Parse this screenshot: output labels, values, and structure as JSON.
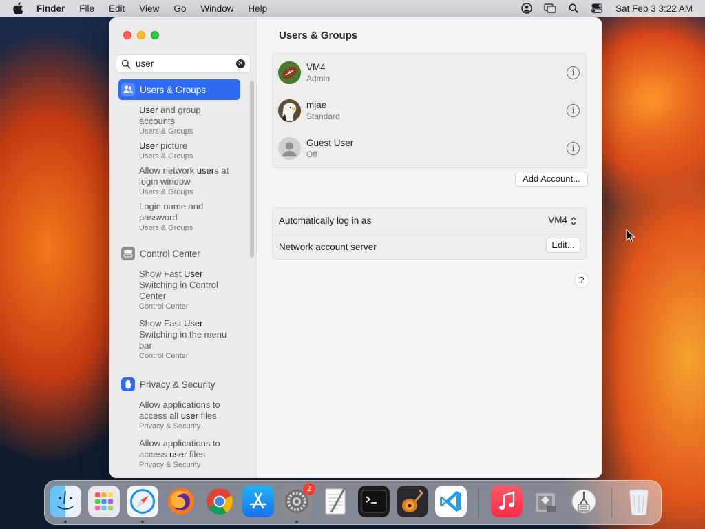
{
  "menubar": {
    "items": [
      "Finder",
      "File",
      "Edit",
      "View",
      "Go",
      "Window",
      "Help"
    ],
    "clock": "Sat Feb 3  3:22 AM"
  },
  "window": {
    "search": {
      "value": "user"
    },
    "sidebar": {
      "categories": [
        {
          "label_hl": "User",
          "label_rest": "s & Groups",
          "results": [
            {
              "pre": "",
              "hl": "User",
              "post": " and group accounts",
              "sub": "Users & Groups"
            },
            {
              "pre": "",
              "hl": "User",
              "post": " picture",
              "sub": "Users & Groups"
            },
            {
              "pre": "Allow network ",
              "hl": "user",
              "post": "s at login window",
              "sub": "Users & Groups"
            },
            {
              "pre": "Login name and password",
              "hl": "",
              "post": "",
              "sub": "Users & Groups"
            }
          ]
        },
        {
          "label_hl": "",
          "label_rest": "Control Center",
          "results": [
            {
              "pre": "Show Fast ",
              "hl": "User",
              "post": " Switching in Control Center",
              "sub": "Control Center"
            },
            {
              "pre": "Show Fast ",
              "hl": "User",
              "post": " Switching in the menu bar",
              "sub": "Control Center"
            }
          ]
        },
        {
          "label_hl": "",
          "label_rest": "Privacy & Security",
          "results": [
            {
              "pre": "Allow applications to access all ",
              "hl": "user",
              "post": " files",
              "sub": "Privacy & Security"
            },
            {
              "pre": "Allow applications to access ",
              "hl": "user",
              "post": " files",
              "sub": "Privacy & Security"
            }
          ]
        }
      ]
    },
    "main": {
      "title": "Users & Groups",
      "users": [
        {
          "name": "VM4",
          "role": "Admin"
        },
        {
          "name": "mjae",
          "role": "Standard"
        },
        {
          "name": "Guest User",
          "role": "Off"
        }
      ],
      "add_account": "Add Account...",
      "autologin_label": "Automatically log in as",
      "autologin_value": "VM4",
      "network_label": "Network account server",
      "edit_label": "Edit...",
      "help": "?",
      "info_glyph": "i"
    }
  },
  "dock": {
    "system_settings_badge": "2",
    "apps": [
      "Finder",
      "Launchpad",
      "Safari",
      "Firefox",
      "Chrome",
      "App Store",
      "System Settings",
      "TextEdit",
      "Terminal",
      "GarageBand",
      "Visual Studio Code",
      "Music",
      "Boot Camp Assistant",
      "Directory Utility",
      "Trash"
    ]
  },
  "colors": {
    "accent": "#2e6bf0",
    "close": "#fe5f57",
    "minimize": "#febc2e",
    "zoom": "#28c840",
    "badge": "#ff3b30"
  }
}
